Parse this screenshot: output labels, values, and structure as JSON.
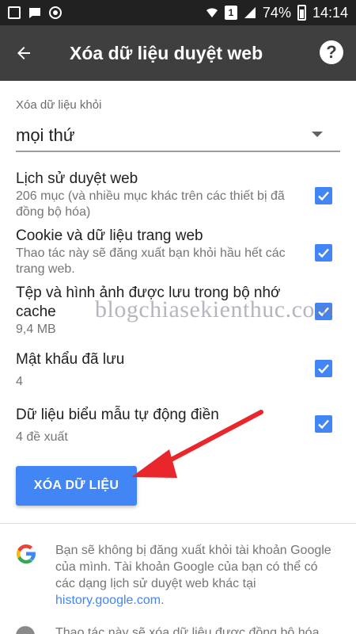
{
  "status_bar": {
    "battery": "74%",
    "time": "14:14",
    "badge": "1"
  },
  "toolbar": {
    "title": "Xóa dữ liệu duyệt web"
  },
  "range": {
    "label": "Xóa dữ liệu khỏi",
    "value": "mọi thứ"
  },
  "options": [
    {
      "title": "Lịch sử duyệt web",
      "subtitle": "206 mục (và nhiều mục khác trên các thiết bị đã đồng bộ hóa)",
      "checked": true
    },
    {
      "title": "Cookie và dữ liệu trang web",
      "subtitle": "Thao tác này sẽ đăng xuất bạn khỏi hầu hết các trang web.",
      "checked": true
    },
    {
      "title": "Tệp và hình ảnh được lưu trong bộ nhớ cache",
      "subtitle": "9,4 MB",
      "checked": true
    },
    {
      "title": "Mật khẩu đã lưu",
      "subtitle": "4",
      "checked": true
    },
    {
      "title": "Dữ liệu biểu mẫu tự động điền",
      "subtitle": "4 đề xuất",
      "checked": true
    }
  ],
  "clear_button": {
    "label": "XÓA DỮ LIỆU"
  },
  "info": {
    "text": "Bạn sẽ không bị đăng xuất khỏi tài khoản Google của mình. Tài khoản Google của bạn có thể có các dạng lịch sử duyệt web khác tại",
    "link": "history.google.com",
    "suffix": "."
  },
  "info2": {
    "text": "Thao tác này sẽ xóa dữ liệu được đồng bộ hóa"
  },
  "watermark": "blogchiasekienthuc.com",
  "colors": {
    "accent": "#4285f4",
    "toolbar": "#3f3f3f",
    "arrow": "#e8262b"
  }
}
